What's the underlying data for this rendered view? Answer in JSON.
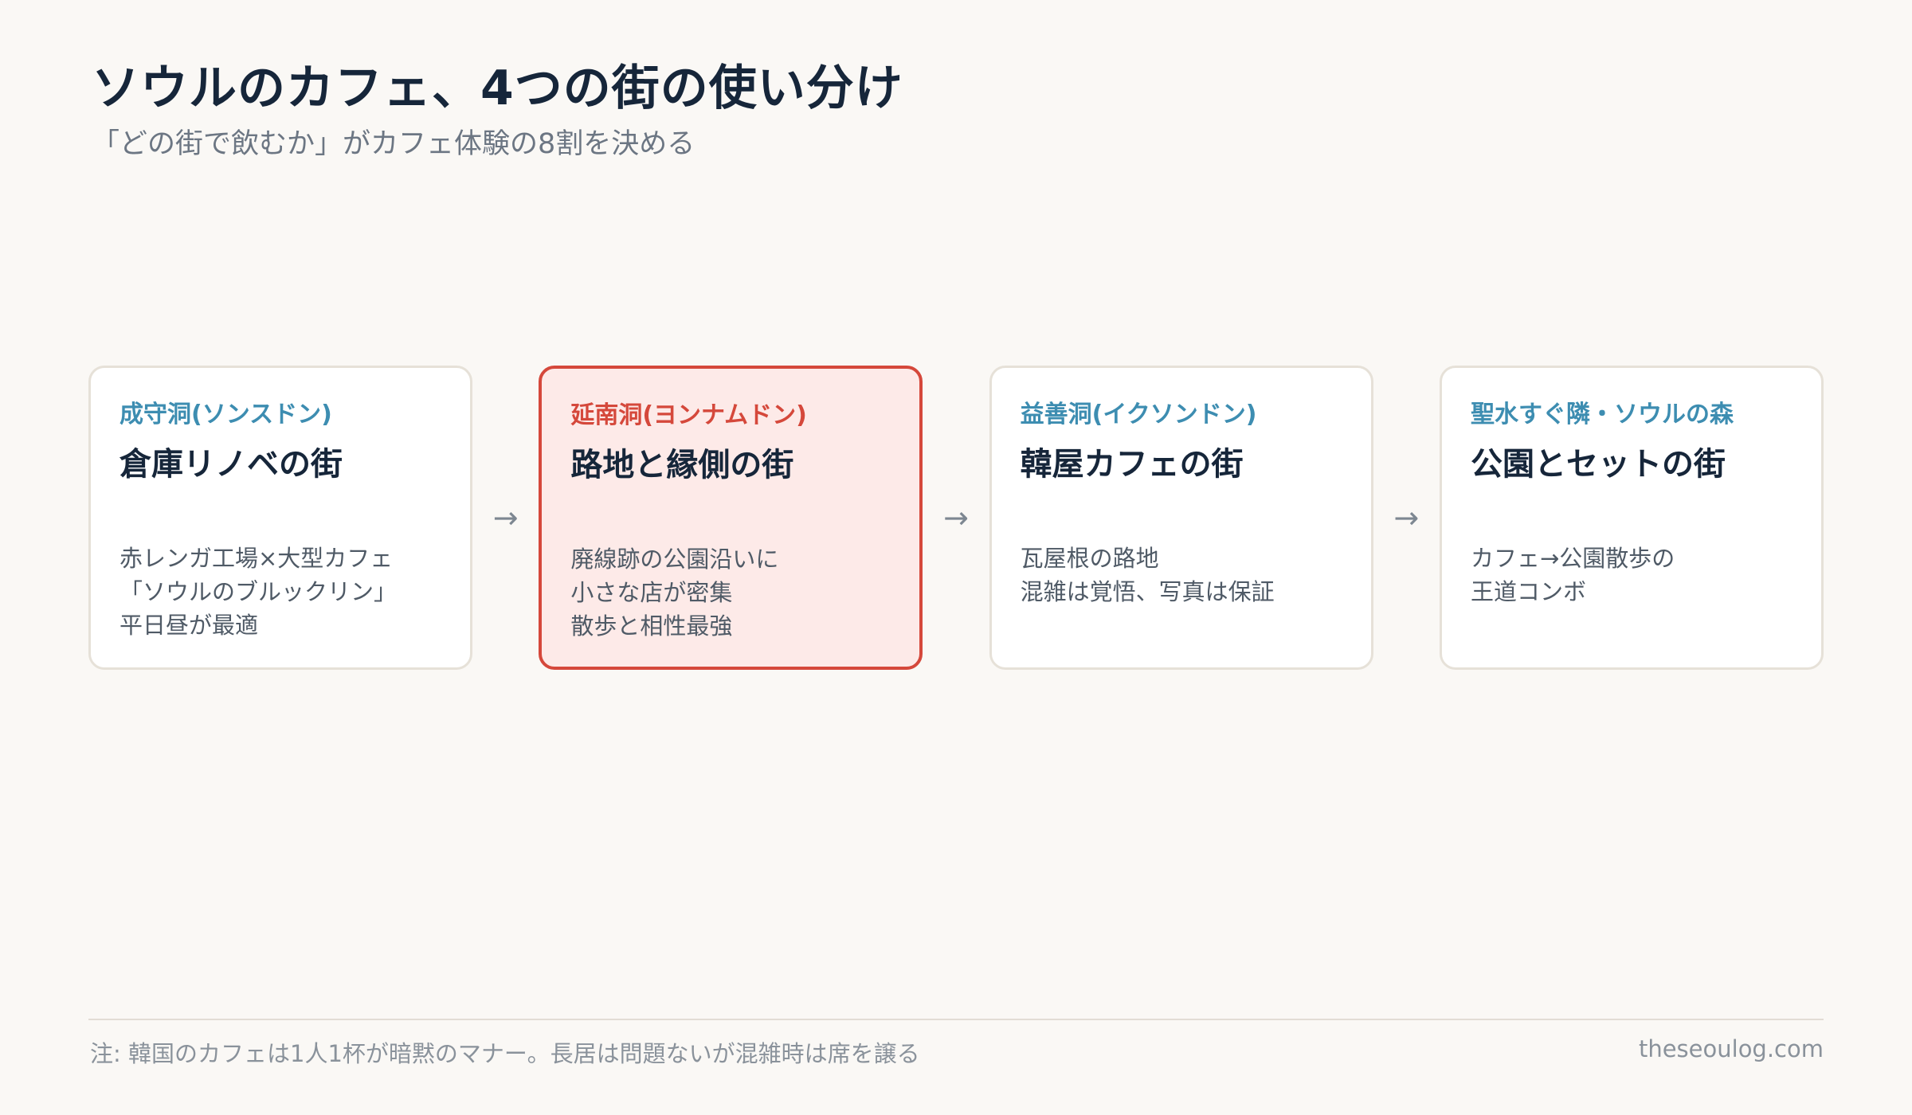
{
  "header": {
    "title": "ソウルのカフェ、4つの街の使い分け",
    "subtitle": "「どの街で飲むか」がカフェ体験の8割を決める"
  },
  "cards": [
    {
      "area": "成守洞(ソンスドン)",
      "heading": "倉庫リノベの街",
      "lines": [
        "赤レンガ工場×大型カフェ",
        "「ソウルのブルックリン」",
        "平日昼が最適"
      ]
    },
    {
      "area": "延南洞(ヨンナムドン)",
      "heading": "路地と縁側の街",
      "lines": [
        "廃線跡の公園沿いに",
        "小さな店が密集",
        "散歩と相性最強"
      ]
    },
    {
      "area": "益善洞(イクソンドン)",
      "heading": "韓屋カフェの街",
      "lines": [
        "瓦屋根の路地",
        "混雑は覚悟、写真は保証"
      ]
    },
    {
      "area": "聖水すぐ隣・ソウルの森",
      "heading": "公園とセットの街",
      "lines": [
        "カフェ→公園散歩の",
        "王道コンボ"
      ]
    }
  ],
  "arrow_glyph": "→",
  "footer": {
    "note": "注: 韓国のカフェは1人1杯が暗黙のマナー。長居は問題ないが混雑時は席を譲る",
    "source": "theseoulog.com"
  },
  "colors": {
    "accent_blue": "#3d8db1",
    "accent_red": "#d5483b",
    "highlight_bg": "#fdeae8"
  }
}
